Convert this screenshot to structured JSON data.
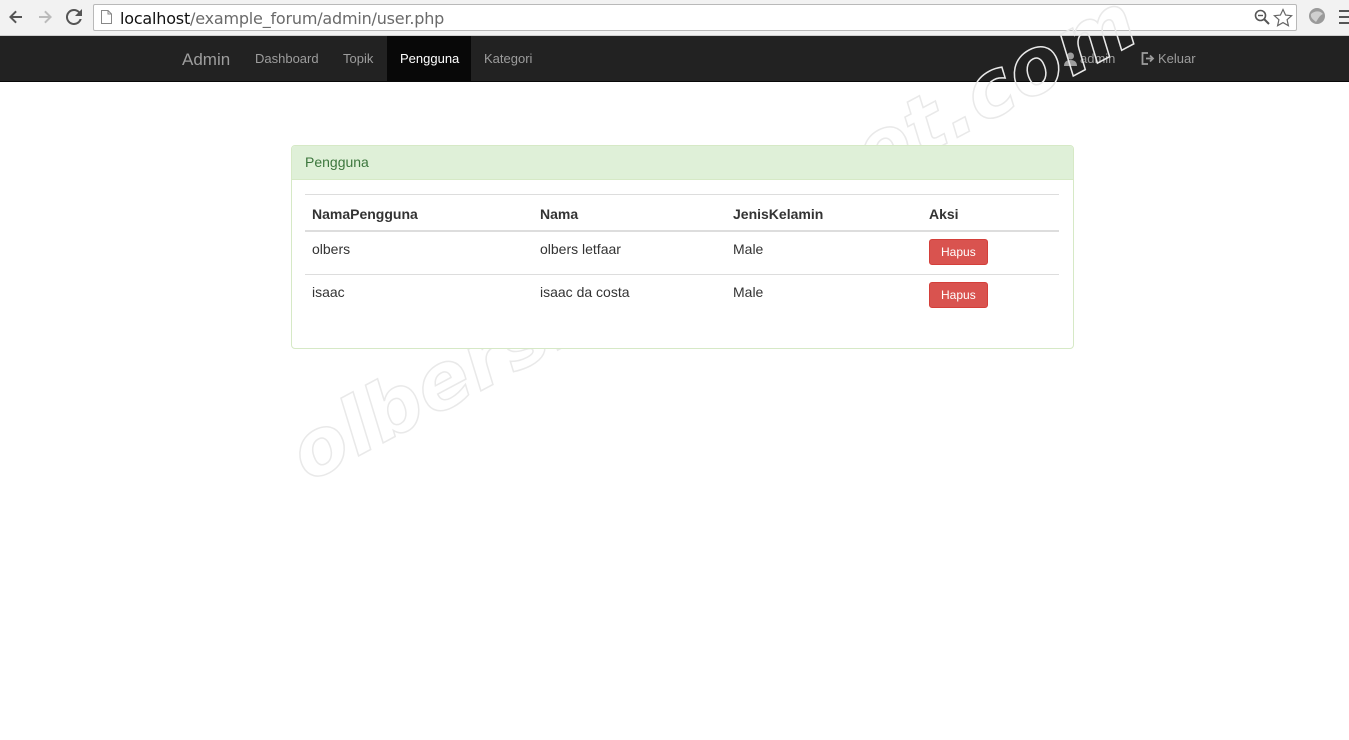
{
  "browser": {
    "url_host": "localhost",
    "url_path": "/example_forum/admin/user.php"
  },
  "navbar": {
    "brand": "Admin",
    "items": [
      {
        "label": "Dashboard",
        "active": false
      },
      {
        "label": "Topik",
        "active": false
      },
      {
        "label": "Pengguna",
        "active": true
      },
      {
        "label": "Kategori",
        "active": false
      }
    ],
    "user_label": "admin",
    "logout_label": "Keluar"
  },
  "panel": {
    "title": "Pengguna",
    "columns": [
      "NamaPengguna",
      "Nama",
      "JenisKelamin",
      "Aksi"
    ],
    "rows": [
      {
        "username": "olbers",
        "name": "olbers letfaar",
        "gender": "Male",
        "action": "Hapus"
      },
      {
        "username": "isaac",
        "name": "isaac da costa",
        "gender": "Male",
        "action": "Hapus"
      }
    ]
  },
  "watermark": "olbersl.blogspot.com",
  "colors": {
    "navbar_bg": "#222222",
    "navbar_active": "#080808",
    "panel_heading_bg": "#dff0d8",
    "panel_heading_text": "#3c763d",
    "danger": "#d9534f"
  }
}
